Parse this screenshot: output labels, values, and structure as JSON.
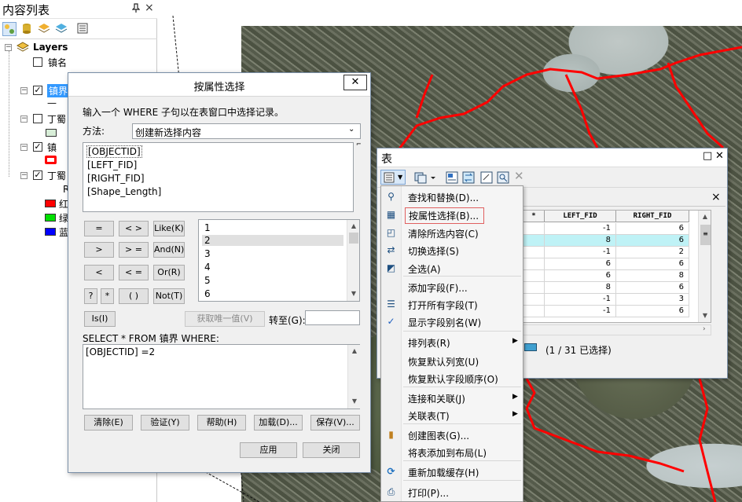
{
  "toc": {
    "title": "内容列表",
    "pin_icon": "pin-icon",
    "close_label": "×",
    "layers_root": "Layers",
    "layers": [
      {
        "label": "镇名",
        "checked": false
      },
      {
        "label": "镇界",
        "checked": true
      },
      {
        "label": "丁蜀",
        "checked": false
      },
      {
        "label": "镇",
        "checked": true
      },
      {
        "label": "丁蜀",
        "checked": true
      }
    ],
    "legend": [
      {
        "label": "R",
        "color": ""
      },
      {
        "label": "红",
        "color": "#ff0000"
      },
      {
        "label": "绿",
        "color": "#00e000"
      },
      {
        "label": "蓝",
        "color": "#0000ff"
      }
    ],
    "line_legend": "—",
    "swatch_green": "#d8eed8"
  },
  "dialog": {
    "title": "按属性选择",
    "close_label": "✕",
    "intro": "输入一个 WHERE 子句以在表窗口中选择记录。",
    "method_label": "方法:",
    "method_value": "创建新选择内容",
    "fields": [
      "[OBJECTID]",
      "[LEFT_FID]",
      "[RIGHT_FID]",
      "[Shape_Length]"
    ],
    "operators": [
      "=",
      "< >",
      "Like(K)",
      ">",
      "> =",
      "And(N)",
      "<",
      "< =",
      "Or(R)",
      "?",
      "*",
      "( )",
      "Not(T)"
    ],
    "values": [
      "1",
      "2",
      "3",
      "4",
      "5",
      "6"
    ],
    "is_button": "Is(I)",
    "unique_button": "获取唯一值(V)",
    "goto_label": "转至(G):",
    "goto_value": "",
    "select_from": "SELECT * FROM 镇界 WHERE:",
    "expression": "[OBJECTID] =2",
    "buttons": [
      "清除(E)",
      "验证(Y)",
      "帮助(H)",
      "加载(D)...",
      "保存(V)..."
    ],
    "apply": "应用",
    "close": "关闭"
  },
  "table": {
    "title": "表",
    "close_label": "✕",
    "restore_label": "□",
    "subclose_label": "×",
    "columns": [
      "*",
      "LEFT_FID",
      "RIGHT_FID"
    ],
    "rows": [
      {
        "left": "-1",
        "right": "6",
        "selected": false
      },
      {
        "left": "8",
        "right": "6",
        "selected": true
      },
      {
        "left": "-1",
        "right": "2",
        "selected": false
      },
      {
        "left": "6",
        "right": "6",
        "selected": false
      },
      {
        "left": "6",
        "right": "8",
        "selected": false
      },
      {
        "left": "8",
        "right": "6",
        "selected": false
      },
      {
        "left": "-1",
        "right": "3",
        "selected": false
      },
      {
        "left": "-1",
        "right": "6",
        "selected": false
      }
    ],
    "status": "(1 / 31 已选择)",
    "selected_row_color": "#bff2f6"
  },
  "menu": {
    "items": [
      {
        "label": "查找和替换(D)...",
        "icon": "binoculars-icon",
        "glyph": "⚲",
        "submenu": false
      },
      {
        "label": "按属性选择(B)...",
        "icon": "select-by-attributes-icon",
        "glyph": "▦",
        "submenu": false,
        "highlighted": true
      },
      {
        "label": "清除所选内容(C)",
        "icon": "clear-selection-icon",
        "glyph": "◰",
        "submenu": false
      },
      {
        "label": "切换选择(S)",
        "icon": "switch-selection-icon",
        "glyph": "⇄",
        "submenu": false
      },
      {
        "label": "全选(A)",
        "icon": "select-all-icon",
        "glyph": "◩",
        "submenu": false
      },
      {
        "label": "添加字段(F)...",
        "icon": "",
        "glyph": "",
        "submenu": false
      },
      {
        "label": "打开所有字段(T)",
        "icon": "list-icon",
        "glyph": "☰",
        "submenu": false
      },
      {
        "label": "显示字段别名(W)",
        "icon": "check-icon",
        "glyph": "✓",
        "submenu": false
      },
      {
        "label": "排列表(R)",
        "icon": "",
        "glyph": "",
        "submenu": true
      },
      {
        "label": "恢复默认列宽(U)",
        "icon": "",
        "glyph": "",
        "submenu": false
      },
      {
        "label": "恢复默认字段顺序(O)",
        "icon": "",
        "glyph": "",
        "submenu": false
      },
      {
        "label": "连接和关联(J)",
        "icon": "",
        "glyph": "",
        "submenu": true
      },
      {
        "label": "关联表(T)",
        "icon": "",
        "glyph": "",
        "submenu": true
      },
      {
        "label": "创建图表(G)...",
        "icon": "chart-icon",
        "glyph": "▮",
        "submenu": false
      },
      {
        "label": "将表添加到布局(L)",
        "icon": "",
        "glyph": "",
        "submenu": false
      },
      {
        "label": "重新加载缓存(H)",
        "icon": "reload-icon",
        "glyph": "⟳",
        "submenu": false
      },
      {
        "label": "打印(P)...",
        "icon": "print-icon",
        "glyph": "⎙",
        "submenu": false
      }
    ],
    "highlight_border": "#e06060"
  },
  "colors": {
    "boundary": "#ff0000",
    "accent": "#0078d7"
  }
}
